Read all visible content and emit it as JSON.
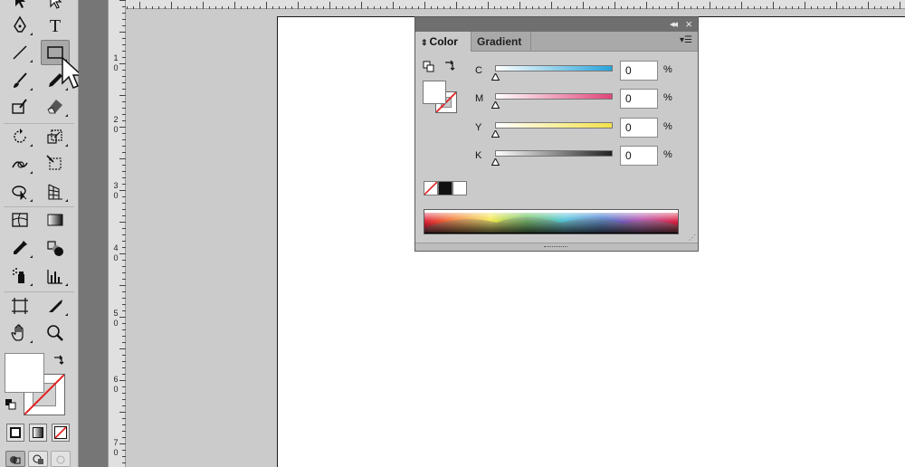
{
  "tools_panel": {
    "tools": [
      {
        "id": "selection-tool",
        "icon": "selection-arrow-icon"
      },
      {
        "id": "direct-selection-tool",
        "icon": "direct-selection-arrow-icon"
      },
      {
        "id": "pen-tool",
        "icon": "pen-icon"
      },
      {
        "id": "type-tool",
        "icon": "type-icon",
        "glyph": "T"
      },
      {
        "id": "line-tool",
        "icon": "line-segment-icon"
      },
      {
        "id": "rectangle-tool",
        "icon": "rectangle-icon",
        "selected": true
      },
      {
        "id": "paintbrush-tool",
        "icon": "paintbrush-icon"
      },
      {
        "id": "pencil-tool",
        "icon": "pencil-icon"
      },
      {
        "id": "blob-brush-tool",
        "icon": "blob-brush-icon"
      },
      {
        "id": "eraser-tool",
        "icon": "eraser-icon"
      },
      {
        "id": "rotate-tool",
        "icon": "rotate-icon"
      },
      {
        "id": "scale-tool",
        "icon": "scale-icon"
      },
      {
        "id": "warp-tool",
        "icon": "warp-icon"
      },
      {
        "id": "free-transform-tool",
        "icon": "free-transform-icon"
      },
      {
        "id": "shape-builder-tool",
        "icon": "shape-builder-icon"
      },
      {
        "id": "perspective-grid-tool",
        "icon": "perspective-grid-icon"
      },
      {
        "id": "mesh-tool",
        "icon": "mesh-icon"
      },
      {
        "id": "gradient-tool",
        "icon": "gradient-icon"
      },
      {
        "id": "eyedropper-tool",
        "icon": "eyedropper-icon"
      },
      {
        "id": "blend-tool",
        "icon": "blend-icon"
      },
      {
        "id": "symbol-sprayer-tool",
        "icon": "symbol-sprayer-icon"
      },
      {
        "id": "column-graph-tool",
        "icon": "column-graph-icon"
      },
      {
        "id": "artboard-tool",
        "icon": "artboard-icon"
      },
      {
        "id": "slice-tool",
        "icon": "slice-knife-icon"
      },
      {
        "id": "hand-tool",
        "icon": "hand-icon"
      },
      {
        "id": "zoom-tool",
        "icon": "zoom-magnifier-icon"
      }
    ],
    "fill_color": "#ffffff",
    "stroke": "none",
    "color_modes": [
      "color-mode-icon",
      "gradient-mode-icon",
      "none-mode-icon"
    ],
    "draw_modes": [
      "draw-normal-icon",
      "draw-behind-icon",
      "draw-inside-icon"
    ]
  },
  "vertical_ruler": {
    "labels": [
      {
        "top": "1",
        "bottom": "0"
      },
      {
        "top": "2",
        "bottom": "0"
      },
      {
        "top": "3",
        "bottom": "0"
      },
      {
        "top": "4",
        "bottom": "0"
      },
      {
        "top": "5",
        "bottom": "0"
      },
      {
        "top": "6",
        "bottom": "0"
      },
      {
        "top": "7",
        "bottom": "0"
      }
    ]
  },
  "color_panel": {
    "tabs": [
      {
        "label": "Color",
        "active": true,
        "icon": "updown-arrows-icon"
      },
      {
        "label": "Gradient",
        "active": false
      }
    ],
    "collapse_icon": "double-chevron-left-icon",
    "close_icon": "close-x-icon",
    "menu_icon": "panel-menu-icon",
    "sliders": [
      {
        "label": "C",
        "value": "0",
        "unit": "%",
        "ramp_color": "#27a3da"
      },
      {
        "label": "M",
        "value": "0",
        "unit": "%",
        "ramp_color": "#e0457a"
      },
      {
        "label": "Y",
        "value": "0",
        "unit": "%",
        "ramp_color": "#f2e14a"
      },
      {
        "label": "K",
        "value": "0",
        "unit": "%",
        "ramp_color": "#222222"
      }
    ],
    "quick_swatches": [
      "none",
      "#111111",
      "#ffffff"
    ]
  }
}
